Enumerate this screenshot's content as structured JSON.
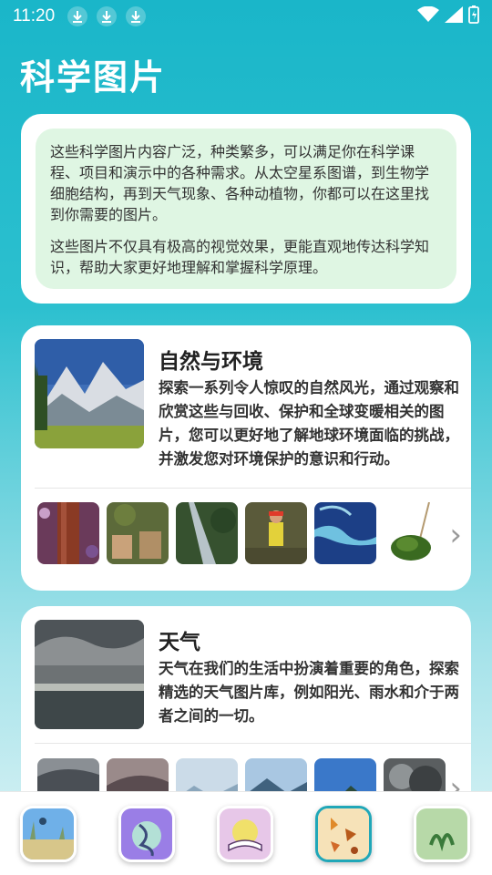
{
  "status": {
    "time": "11:20"
  },
  "page": {
    "title": "科学图片"
  },
  "intro": {
    "paragraph1": "这些科学图片内容广泛，种类繁多，可以满足你在科学课程、项目和演示中的各种需求。从太空星系图谱，到生物学细胞结构，再到天气现象、各种动植物，你都可以在这里找到你需要的图片。",
    "paragraph2": "这些图片不仅具有极高的视觉效果，更能直观地传达科学知识，帮助大家更好地理解和掌握科学原理。"
  },
  "categories": [
    {
      "title": "自然与环境",
      "description": "探索一系列令人惊叹的自然风光，通过观察和欣赏这些与回收、保护和全球变暖相关的图片，您可以更好地了解地球环境面临的挑战，并激发您对环境保护的意识和行动。"
    },
    {
      "title": "天气",
      "description": "天气在我们的生活中扮演着重要的角色，探索精选的天气图片库，例如阳光、雨水和介于两者之间的一切。"
    }
  ],
  "bottom_nav": {
    "active_index": 3,
    "items": [
      "nature-nav-icon",
      "biology-nav-icon",
      "education-nav-icon",
      "autumn-leaves-nav-icon",
      "plants-nav-icon"
    ]
  },
  "colors": {
    "accent": "#20a7b8",
    "intro_bg": "#dff6e3"
  }
}
